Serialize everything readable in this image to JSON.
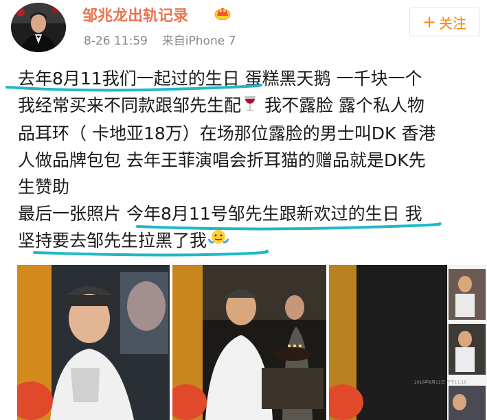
{
  "header": {
    "username": "邹兆龙出轨记录",
    "time": "8-26 11:59",
    "source": "来自iPhone 7",
    "follow_label": "关注",
    "follow_plus": "+",
    "badge_icon": "crown-vip-icon"
  },
  "post": {
    "lines": [
      {
        "a": "去年8月11我们一起过的生日",
        "b": " 蛋糕黑天鹅 一千块一个"
      },
      {
        "a": "我经常买来不同款跟邹先生配",
        "b": " 我不露脸 露个私人物"
      },
      {
        "a": "品耳环（ 卡地亚18万）在场那位露脸的男士叫DK 香港",
        "b": ""
      },
      {
        "a": "人做品牌包包 去年王菲演唱会折耳猫的赠品就是DK先",
        "b": ""
      },
      {
        "a": "生赞助",
        "b": ""
      },
      {
        "a": "最后一张照片 今年8月11号邹先生跟新欢过的生日",
        "b": " 我"
      },
      {
        "a": "坚持要去邹先生拉黑了我",
        "b": ""
      }
    ],
    "emoji_1": "wine-glass-emoji",
    "emoji_2": "shrug-emoji",
    "highlight_color": "#1fb8c8"
  },
  "photos": {
    "count": 3,
    "screen_caption": "2016年8月11日 下午11:18"
  },
  "colors": {
    "username": "#eb7350",
    "follow": "#ff8200",
    "meta": "#8a8a8a",
    "text": "#1a1a1a"
  }
}
